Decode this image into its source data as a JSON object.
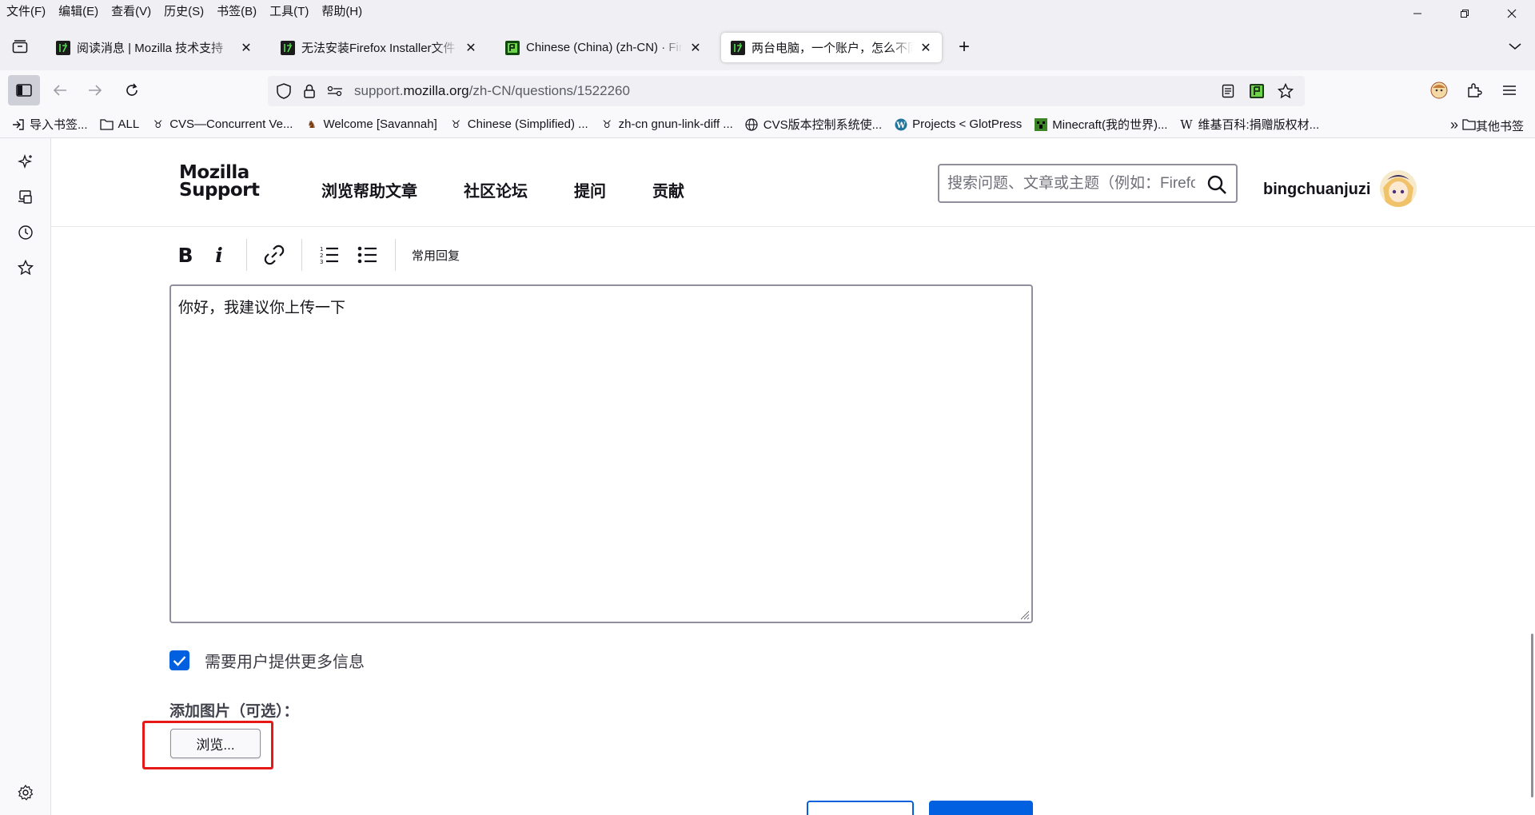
{
  "menu": [
    "文件(F)",
    "编辑(E)",
    "查看(V)",
    "历史(S)",
    "书签(B)",
    "工具(T)",
    "帮助(H)"
  ],
  "tabs": [
    {
      "title": "阅读消息 | Mozilla 技术支持",
      "favicon": "mozilla-support-favicon",
      "active": false
    },
    {
      "title": "无法安装Firefox Installer文件 |",
      "favicon": "mozilla-support-favicon",
      "active": false
    },
    {
      "title": "Chinese (China) (zh-CN) · Firefox",
      "favicon": "pontoon-favicon",
      "active": false
    },
    {
      "title": "两台电脑，一个账户，怎么不同",
      "favicon": "mozilla-support-favicon",
      "active": true
    }
  ],
  "url": {
    "prefix": "support.",
    "host": "mozilla.org",
    "path": "/zh-CN/questions/1522260"
  },
  "bookmarks": [
    {
      "label": "导入书签...",
      "icon": "import-icon"
    },
    {
      "label": "ALL",
      "icon": "folder-icon"
    },
    {
      "label": "CVS—Concurrent Ve...",
      "icon": "gnu-icon"
    },
    {
      "label": "Welcome [Savannah]",
      "icon": "savannah-icon"
    },
    {
      "label": "Chinese (Simplified) ...",
      "icon": "gnu-icon"
    },
    {
      "label": "zh-cn gnun-link-diff ...",
      "icon": "gnu-icon"
    },
    {
      "label": "CVS版本控制系统使...",
      "icon": "globe-icon"
    },
    {
      "label": "Projects < GlotPress",
      "icon": "wordpress-icon"
    },
    {
      "label": "Minecraft(我的世界)...",
      "icon": "minecraft-icon"
    },
    {
      "label": "维基百科:捐赠版权材...",
      "icon": "wikipedia-icon"
    }
  ],
  "bookmarks_other": "其他书签",
  "site": {
    "logo_line1": "Mozilla",
    "logo_line2": "Support",
    "nav": [
      "浏览帮助文章",
      "社区论坛",
      "提问",
      "贡献"
    ],
    "search_placeholder": "搜索问题、文章或主题（例如：Firefox",
    "username": "bingchuanjuzi"
  },
  "editor": {
    "canned_responses": "常用回复",
    "content": "你好，我建议你上传一下",
    "needinfo_label": "需要用户提供更多信息",
    "needinfo_checked": true,
    "upload_label": "添加图片（可选）：",
    "browse_label": "浏览..."
  },
  "colors": {
    "accent": "#0060df",
    "highlight": "#e61919"
  }
}
